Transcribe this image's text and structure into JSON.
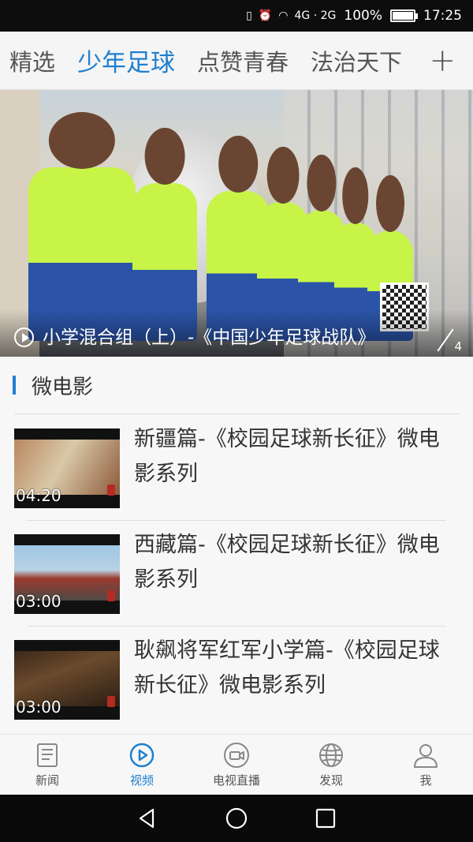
{
  "status": {
    "signal_icons": "4G · 2G",
    "battery_percent": "100%",
    "time": "17:25"
  },
  "top_tabs": [
    {
      "label": "精选"
    },
    {
      "label": "少年足球",
      "active": true
    },
    {
      "label": "点赞青春"
    },
    {
      "label": "法治天下"
    }
  ],
  "add_tab_icon": "plus-icon",
  "hero": {
    "caption": "小学混合组（上）-《中国少年足球战队》",
    "pager_total": "4"
  },
  "section": {
    "title": "微电影"
  },
  "videos": [
    {
      "title": "新疆篇-《校园足球新长征》微电影系列",
      "duration": "04:20",
      "thumb_color": "#8a6a4c"
    },
    {
      "title": "西藏篇-《校园足球新长征》微电影系列",
      "duration": "03:00",
      "thumb_color": "#6f8db0"
    },
    {
      "title": "耿飙将军红军小学篇-《校园足球新长征》微电影系列",
      "duration": "03:00",
      "thumb_color": "#3d2a1c"
    }
  ],
  "bottom_tabs": [
    {
      "label": "新闻",
      "icon": "newspaper-icon"
    },
    {
      "label": "视频",
      "icon": "play-circle-icon",
      "active": true
    },
    {
      "label": "电视直播",
      "icon": "camera-icon"
    },
    {
      "label": "发现",
      "icon": "globe-icon"
    },
    {
      "label": "我",
      "icon": "person-icon"
    }
  ],
  "colors": {
    "accent": "#1e7fd0",
    "text": "#333333"
  }
}
